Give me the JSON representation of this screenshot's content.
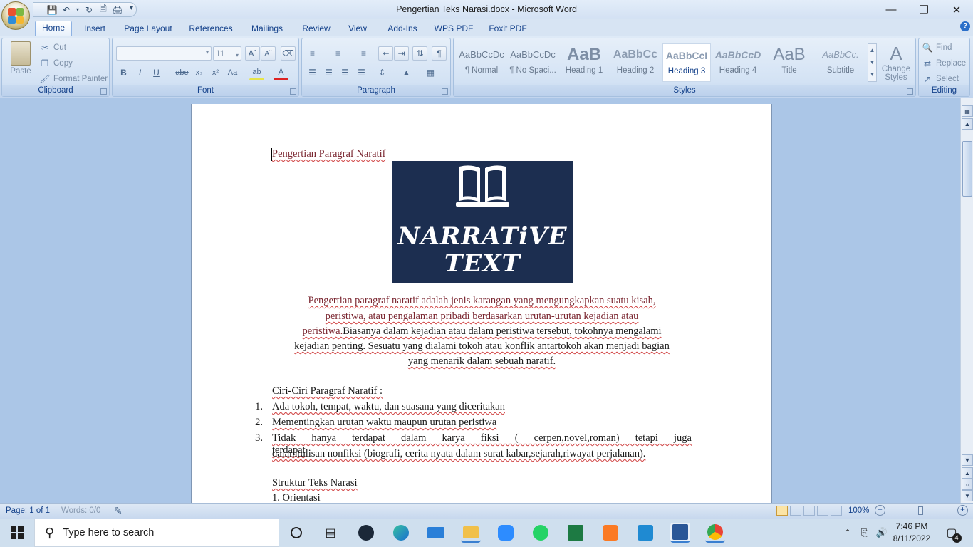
{
  "window": {
    "title": "Pengertian Teks Narasi.docx - Microsoft Word"
  },
  "ribbon": {
    "tabs": [
      "Home",
      "Insert",
      "Page Layout",
      "References",
      "Mailings",
      "Review",
      "View",
      "Add-Ins",
      "WPS PDF",
      "Foxit PDF"
    ],
    "active_tab": "Home",
    "clipboard": {
      "paste": "Paste",
      "cut": "Cut",
      "copy": "Copy",
      "format_painter": "Format Painter",
      "label": "Clipboard"
    },
    "font": {
      "font_name": "",
      "font_size": "11",
      "label": "Font"
    },
    "paragraph": {
      "label": "Paragraph"
    },
    "styles": {
      "label": "Styles",
      "items": [
        {
          "preview": "AaBbCcDc",
          "name": "¶ Normal"
        },
        {
          "preview": "AaBbCcDc",
          "name": "¶ No Spaci..."
        },
        {
          "preview": "AaB",
          "name": "Heading 1"
        },
        {
          "preview": "AaBbCc",
          "name": "Heading 2"
        },
        {
          "preview": "AaBbCcI",
          "name": "Heading 3"
        },
        {
          "preview": "AaBbCcD",
          "name": "Heading 4"
        },
        {
          "preview": "AaB",
          "name": "Title"
        },
        {
          "preview": "AaBbCc.",
          "name": "Subtitle"
        }
      ],
      "selected": "Heading 3",
      "change_styles": "Change Styles"
    },
    "editing": {
      "find": "Find",
      "replace": "Replace",
      "select": "Select",
      "label": "Editing"
    }
  },
  "document": {
    "heading": "Pengertian Paragraf Naratif",
    "image_text": [
      "NARRATiVE",
      "TEXT"
    ],
    "paragraph_lines": [
      "Pengertian paragraf naratif adalah jenis karangan yang mengungkapkan suatu kisah,",
      "peristiwa, atau pengalaman pribadi berdasarkan urutan-urutan kejadian atau",
      "peristiwa.",
      "Biasanya dalam kejadian atau dalam peristiwa tersebut, tokohnya mengalami",
      "kejadian penting. Sesuatu yang dialami tokoh atau konflik antartokoh akan menjadi bagian",
      "yang menarik dalam sebuah naratif."
    ],
    "ciri_heading": "Ciri-Ciri Paragraf Naratif :",
    "ciri_items": [
      {
        "num": "1.",
        "text": "Ada tokoh, tempat, waktu, dan suasana yang diceritakan"
      },
      {
        "num": "2.",
        "text": "Mementingkan urutan waktu maupun urutan peristiwa"
      },
      {
        "num": "3.",
        "text": "Tidak hanya terdapat dalam karya fiksi ( cerpen,novel,roman) tetapi juga terdapat",
        "text2": "dalamtulisan nonfiksi (biografi, cerita nyata dalam surat kabar,sejarah,riwayat perjalanan)."
      }
    ],
    "struktur_heading": "Struktur Teks Narasi",
    "struktur_first": "1. Orientasi"
  },
  "status_bar": {
    "page": "Page: 1 of 1",
    "words": "Words: 0/0",
    "zoom": "100%"
  },
  "taskbar": {
    "search_placeholder": "Type here to search",
    "time": "7:46 PM",
    "date": "8/11/2022",
    "notifications": "4"
  }
}
